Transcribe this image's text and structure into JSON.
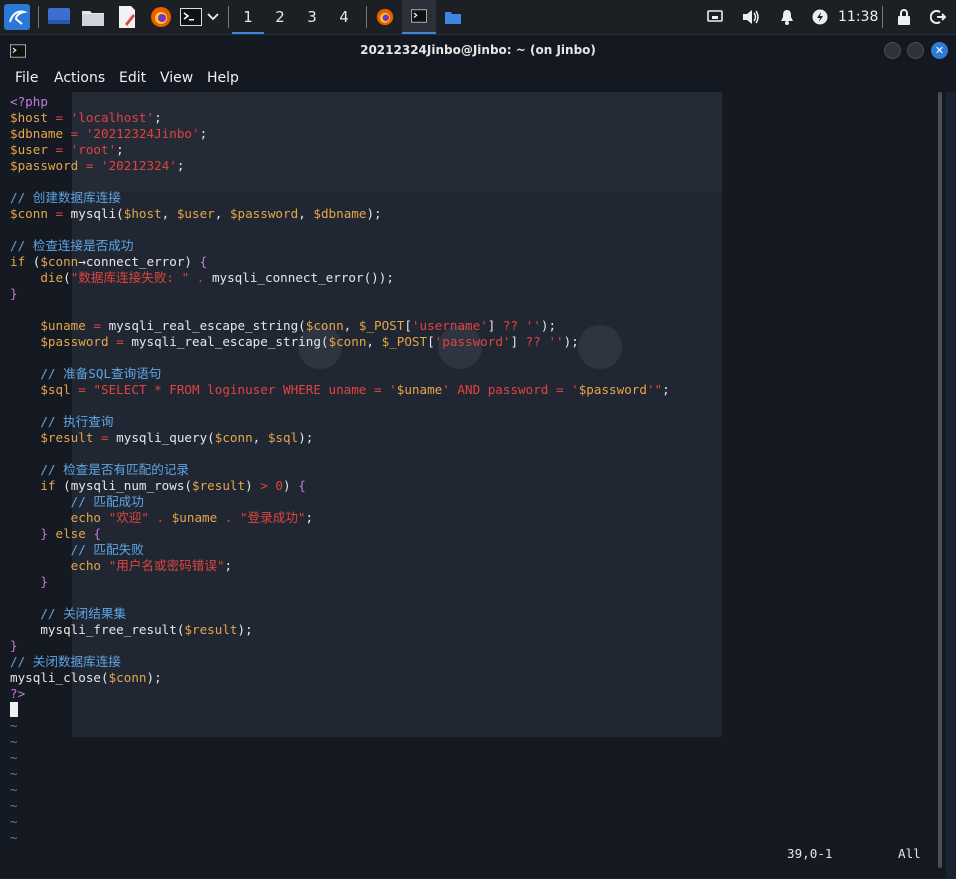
{
  "taskbar": {
    "workspaces": [
      "1",
      "2",
      "3",
      "4"
    ],
    "active_workspace": "1",
    "clock": "11:38"
  },
  "window": {
    "title": "20212324Jinbo@Jinbo: ~ (on Jinbo)",
    "close_symbol": "✕"
  },
  "menu": {
    "file": "File",
    "actions": "Actions",
    "edit": "Edit",
    "view": "View",
    "help": "Help"
  },
  "colors": {
    "string": "#e0443e",
    "variable": "#e5a54b",
    "comment": "#5ea5e3",
    "tag": "#c678dd",
    "accent": "#3b86d8"
  },
  "code_lines": [
    [
      {
        "t": "<?php",
        "c": "tag"
      }
    ],
    [
      {
        "t": "$host",
        "c": "var"
      },
      {
        "t": " = ",
        "c": "op"
      },
      {
        "t": "'localhost'",
        "c": "str"
      },
      {
        "t": ";",
        "c": ""
      }
    ],
    [
      {
        "t": "$dbname",
        "c": "var"
      },
      {
        "t": " = ",
        "c": "op"
      },
      {
        "t": "'20212324Jinbo'",
        "c": "str"
      },
      {
        "t": ";",
        "c": ""
      }
    ],
    [
      {
        "t": "$user",
        "c": "var"
      },
      {
        "t": " = ",
        "c": "op"
      },
      {
        "t": "'root'",
        "c": "str"
      },
      {
        "t": ";",
        "c": ""
      }
    ],
    [
      {
        "t": "$password",
        "c": "var"
      },
      {
        "t": " = ",
        "c": "op"
      },
      {
        "t": "'20212324'",
        "c": "str"
      },
      {
        "t": ";",
        "c": ""
      }
    ],
    [],
    [
      {
        "t": "// 创建数据库连接",
        "c": "cmt"
      }
    ],
    [
      {
        "t": "$conn",
        "c": "var"
      },
      {
        "t": " = ",
        "c": "op"
      },
      {
        "t": "mysqli(",
        "c": ""
      },
      {
        "t": "$host",
        "c": "var"
      },
      {
        "t": ", ",
        "c": ""
      },
      {
        "t": "$user",
        "c": "var"
      },
      {
        "t": ", ",
        "c": ""
      },
      {
        "t": "$password",
        "c": "var"
      },
      {
        "t": ", ",
        "c": ""
      },
      {
        "t": "$dbname",
        "c": "var"
      },
      {
        "t": ");",
        "c": ""
      }
    ],
    [],
    [
      {
        "t": "// 检查连接是否成功",
        "c": "cmt"
      }
    ],
    [
      {
        "t": "if",
        "c": "kw"
      },
      {
        "t": " (",
        "c": ""
      },
      {
        "t": "$conn",
        "c": "var"
      },
      {
        "t": "→connect_error) ",
        "c": ""
      },
      {
        "t": "{",
        "c": "tag"
      }
    ],
    [
      {
        "t": "    ",
        "c": ""
      },
      {
        "t": "die",
        "c": "kw"
      },
      {
        "t": "(",
        "c": ""
      },
      {
        "t": "\"数据库连接失败: \"",
        "c": "str"
      },
      {
        "t": " . ",
        "c": "op"
      },
      {
        "t": "mysqli_connect_error());",
        "c": ""
      }
    ],
    [
      {
        "t": "}",
        "c": "tag"
      }
    ],
    [],
    [
      {
        "t": "    ",
        "c": ""
      },
      {
        "t": "$uname",
        "c": "var"
      },
      {
        "t": " = ",
        "c": "op"
      },
      {
        "t": "mysqli_real_escape_string(",
        "c": ""
      },
      {
        "t": "$conn",
        "c": "var"
      },
      {
        "t": ", ",
        "c": ""
      },
      {
        "t": "$_POST",
        "c": "var"
      },
      {
        "t": "[",
        "c": ""
      },
      {
        "t": "'username'",
        "c": "str"
      },
      {
        "t": "] ",
        "c": ""
      },
      {
        "t": "??",
        "c": "op"
      },
      {
        "t": " ",
        "c": ""
      },
      {
        "t": "''",
        "c": "str"
      },
      {
        "t": ");",
        "c": ""
      }
    ],
    [
      {
        "t": "    ",
        "c": ""
      },
      {
        "t": "$password",
        "c": "var"
      },
      {
        "t": " = ",
        "c": "op"
      },
      {
        "t": "mysqli_real_escape_string(",
        "c": ""
      },
      {
        "t": "$conn",
        "c": "var"
      },
      {
        "t": ", ",
        "c": ""
      },
      {
        "t": "$_POST",
        "c": "var"
      },
      {
        "t": "[",
        "c": ""
      },
      {
        "t": "'password'",
        "c": "str"
      },
      {
        "t": "] ",
        "c": ""
      },
      {
        "t": "??",
        "c": "op"
      },
      {
        "t": " ",
        "c": ""
      },
      {
        "t": "''",
        "c": "str"
      },
      {
        "t": ");",
        "c": ""
      }
    ],
    [],
    [
      {
        "t": "    ",
        "c": ""
      },
      {
        "t": "// 准备SQL查询语句",
        "c": "cmt"
      }
    ],
    [
      {
        "t": "    ",
        "c": ""
      },
      {
        "t": "$sql",
        "c": "var"
      },
      {
        "t": " = ",
        "c": "op"
      },
      {
        "t": "\"SELECT * FROM loginuser WHERE uname = '",
        "c": "str"
      },
      {
        "t": "$uname",
        "c": "var"
      },
      {
        "t": "' AND password = '",
        "c": "str"
      },
      {
        "t": "$password",
        "c": "var"
      },
      {
        "t": "'\"",
        "c": "str"
      },
      {
        "t": ";",
        "c": ""
      }
    ],
    [],
    [
      {
        "t": "    ",
        "c": ""
      },
      {
        "t": "// 执行查询",
        "c": "cmt"
      }
    ],
    [
      {
        "t": "    ",
        "c": ""
      },
      {
        "t": "$result",
        "c": "var"
      },
      {
        "t": " = ",
        "c": "op"
      },
      {
        "t": "mysqli_query(",
        "c": ""
      },
      {
        "t": "$conn",
        "c": "var"
      },
      {
        "t": ", ",
        "c": ""
      },
      {
        "t": "$sql",
        "c": "var"
      },
      {
        "t": ");",
        "c": ""
      }
    ],
    [],
    [
      {
        "t": "    ",
        "c": ""
      },
      {
        "t": "// 检查是否有匹配的记录",
        "c": "cmt"
      }
    ],
    [
      {
        "t": "    ",
        "c": ""
      },
      {
        "t": "if",
        "c": "kw"
      },
      {
        "t": " (",
        "c": ""
      },
      {
        "t": "mysqli_num_rows(",
        "c": ""
      },
      {
        "t": "$result",
        "c": "var"
      },
      {
        "t": ") ",
        "c": ""
      },
      {
        "t": "> 0",
        "c": "str"
      },
      {
        "t": ") ",
        "c": ""
      },
      {
        "t": "{",
        "c": "tag"
      }
    ],
    [
      {
        "t": "        ",
        "c": ""
      },
      {
        "t": "// 匹配成功",
        "c": "cmt"
      }
    ],
    [
      {
        "t": "        ",
        "c": ""
      },
      {
        "t": "echo",
        "c": "kw"
      },
      {
        "t": " ",
        "c": ""
      },
      {
        "t": "\"欢迎\"",
        "c": "str"
      },
      {
        "t": " . ",
        "c": "op"
      },
      {
        "t": "$uname",
        "c": "var"
      },
      {
        "t": " . ",
        "c": "op"
      },
      {
        "t": "\"登录成功\"",
        "c": "str"
      },
      {
        "t": ";",
        "c": ""
      }
    ],
    [
      {
        "t": "    ",
        "c": ""
      },
      {
        "t": "} ",
        "c": "tag"
      },
      {
        "t": "else",
        "c": "kw"
      },
      {
        "t": " {",
        "c": "tag"
      }
    ],
    [
      {
        "t": "        ",
        "c": ""
      },
      {
        "t": "// 匹配失败",
        "c": "cmt"
      }
    ],
    [
      {
        "t": "        ",
        "c": ""
      },
      {
        "t": "echo",
        "c": "kw"
      },
      {
        "t": " ",
        "c": ""
      },
      {
        "t": "\"用户名或密码错误\"",
        "c": "str"
      },
      {
        "t": ";",
        "c": ""
      }
    ],
    [
      {
        "t": "    ",
        "c": ""
      },
      {
        "t": "}",
        "c": "tag"
      }
    ],
    [],
    [
      {
        "t": "    ",
        "c": ""
      },
      {
        "t": "// 关闭结果集",
        "c": "cmt"
      }
    ],
    [
      {
        "t": "    ",
        "c": ""
      },
      {
        "t": "mysqli_free_result(",
        "c": ""
      },
      {
        "t": "$result",
        "c": "var"
      },
      {
        "t": ");",
        "c": ""
      }
    ],
    [
      {
        "t": "}",
        "c": "tag"
      }
    ],
    [
      {
        "t": "// 关闭数据库连接",
        "c": "cmt"
      }
    ],
    [
      {
        "t": "mysqli_close(",
        "c": ""
      },
      {
        "t": "$conn",
        "c": "var"
      },
      {
        "t": ");",
        "c": ""
      }
    ],
    [
      {
        "t": "?>",
        "c": "tag"
      }
    ]
  ],
  "tilde_count": 8,
  "tilde_char": "~",
  "status": {
    "position": "39,0-1",
    "scroll": "All"
  }
}
